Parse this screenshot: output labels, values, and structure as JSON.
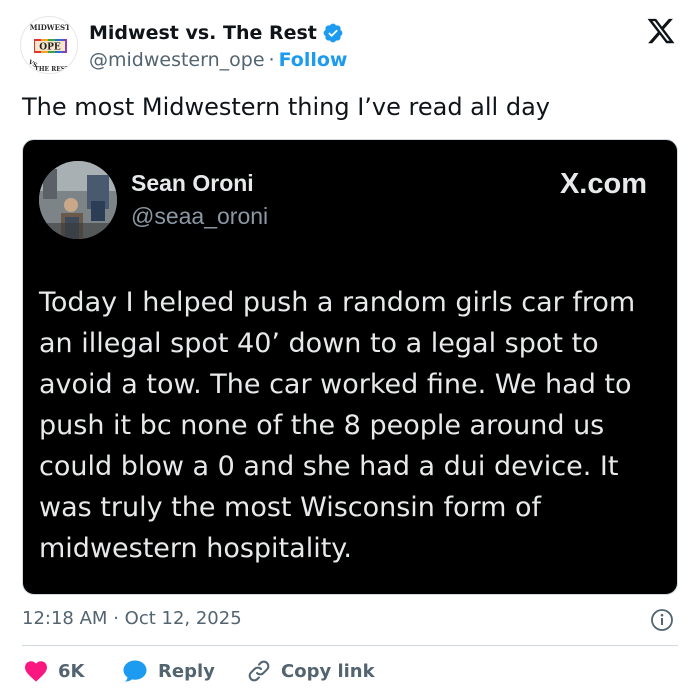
{
  "header": {
    "author_name": "Midwest vs. The Rest",
    "handle": "@midwestern_ope",
    "separator": "·",
    "follow_label": "Follow",
    "logo_text": {
      "top": "MIDWEST",
      "center": "OPE",
      "bottom": "THE REST",
      "left": "VS"
    }
  },
  "tweet": {
    "text": "The most Midwestern thing I’ve read all day"
  },
  "embedded_post": {
    "name": "Sean Oroni",
    "handle": "@seaa_oroni",
    "site": "X.com",
    "body": "Today I helped push a random girls car from an illegal spot 40’ down to a legal spot to avoid a tow. The car worked fine. We had to push it bc none of the 8 people around us could blow a 0 and she had a dui device. It was truly the most Wisconsin form of midwestern hospitality."
  },
  "meta": {
    "time": "12:18 AM",
    "separator": "·",
    "date": "Oct 12, 2025"
  },
  "actions": {
    "likes_count": "6K",
    "reply_label": "Reply",
    "copy_label": "Copy link"
  },
  "colors": {
    "accent": "#1d9bf0",
    "like": "#f91880",
    "text_primary": "#0f1419",
    "text_secondary": "#536471",
    "embed_bg": "#000000"
  },
  "icons": [
    "verified-badge-icon",
    "x-logo-icon",
    "info-icon",
    "heart-icon",
    "reply-bubble-icon",
    "link-icon"
  ]
}
